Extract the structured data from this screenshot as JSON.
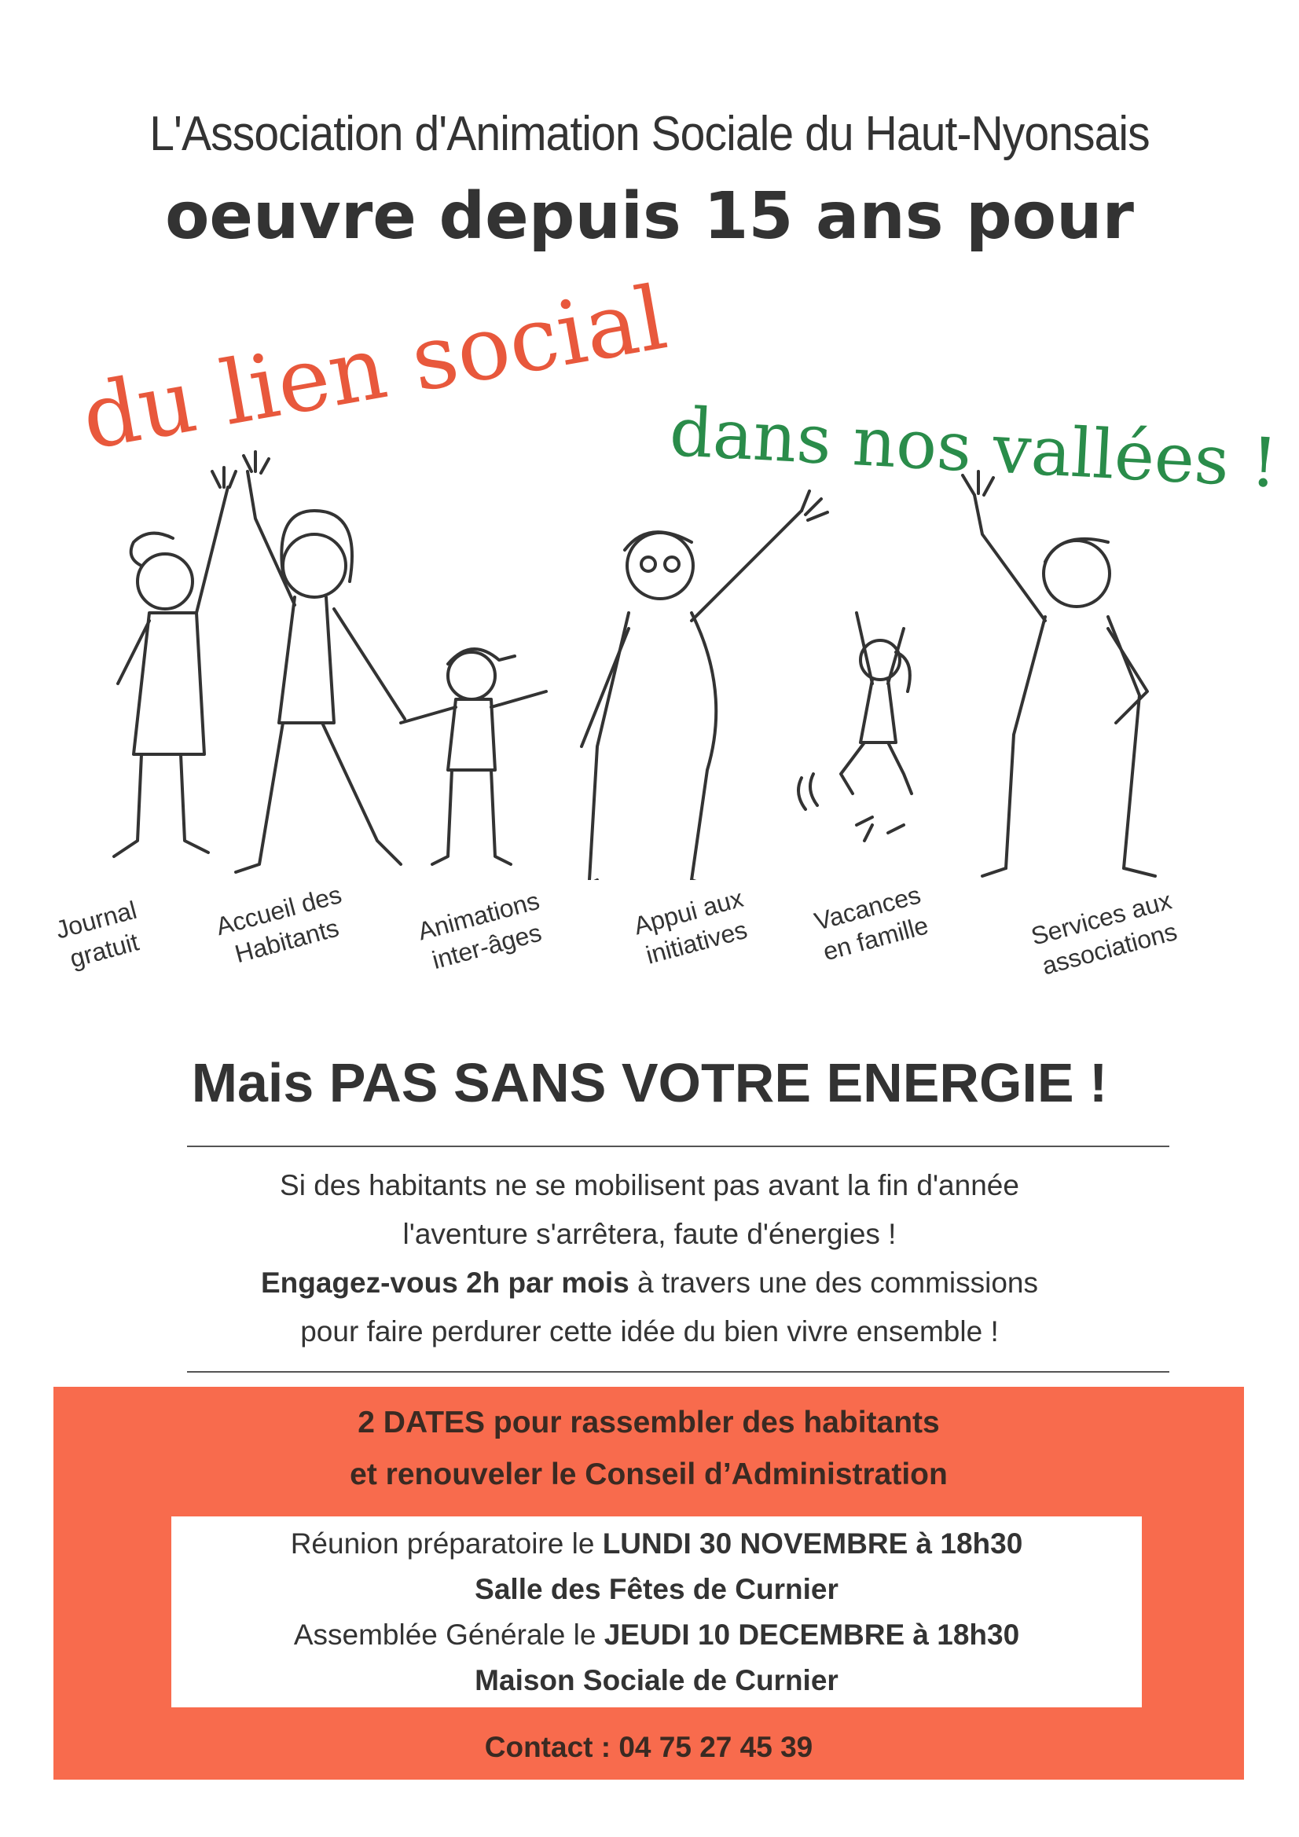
{
  "header": {
    "title_line1": "L'Association d'Animation Sociale du Haut-Nyonsais",
    "title_line2": "oeuvre depuis 15 ans pour"
  },
  "slogan": {
    "red": "du lien social",
    "green": "dans nos vallées !"
  },
  "services": [
    {
      "line1": "Journal",
      "line2": "gratuit"
    },
    {
      "line1": "Accueil des",
      "line2": "Habitants"
    },
    {
      "line1": "Animations",
      "line2": "inter-âges"
    },
    {
      "line1": "Appui aux",
      "line2": "initiatives"
    },
    {
      "line1": "Vacances",
      "line2": "en famille"
    },
    {
      "line1": "Services aux",
      "line2": "associations"
    }
  ],
  "energy_heading": "Mais PAS SANS VOTRE ENERGIE !",
  "message": {
    "line1": "Si des habitants ne se mobilisent pas avant la fin d'année",
    "line2": "l'aventure s'arrêtera, faute d'énergies !",
    "line3_bold": "Engagez-vous 2h par mois",
    "line3_rest": " à travers une des commissions",
    "line4": "pour faire perdurer cette idée du bien vivre ensemble !"
  },
  "dates_box": {
    "heading1": "2 DATES pour rassembler des habitants",
    "heading2": "et renouveler le Conseil d’Administration",
    "meeting1_prefix": "Réunion préparatoire le ",
    "meeting1_date": "LUNDI 30 NOVEMBRE à 18h30",
    "meeting1_place": "Salle des Fêtes de Curnier",
    "meeting2_prefix": "Assemblée Générale le ",
    "meeting2_date": "JEUDI 10 DECEMBRE à 18h30",
    "meeting2_place": "Maison Sociale de Curnier",
    "contact": "Contact : 04 75 27 45 39"
  },
  "colors": {
    "red_slogan": "#e8583c",
    "green_slogan": "#2a8c4a",
    "orange_box": "#f86b4d"
  }
}
